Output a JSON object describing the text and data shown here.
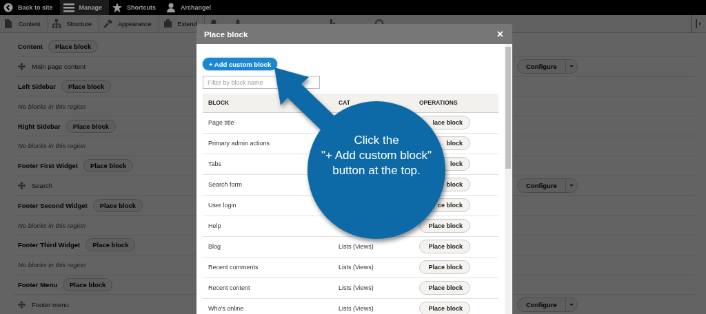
{
  "toolbar": {
    "items": [
      {
        "label": "Back to site",
        "selected": false
      },
      {
        "label": "Manage",
        "selected": true
      },
      {
        "label": "Shortcuts",
        "selected": false
      },
      {
        "label": "Archangel",
        "selected": false
      }
    ]
  },
  "admin_menu": [
    "Content",
    "Structure",
    "Appearance",
    "Extend"
  ],
  "regions": [
    {
      "title": "Content",
      "action": "Place block",
      "rows": [
        {
          "kind": "block",
          "label": "Main page content",
          "button": "Configure"
        }
      ]
    },
    {
      "title": "Left Sidebar",
      "action": "Place block",
      "rows": [
        {
          "kind": "empty",
          "label": "No blocks in this region"
        }
      ]
    },
    {
      "title": "Right Sidebar",
      "action": "Place block",
      "rows": [
        {
          "kind": "empty",
          "label": "No blocks in this region"
        }
      ]
    },
    {
      "title": "Footer First Widget",
      "action": "Place block",
      "rows": [
        {
          "kind": "block",
          "label": "Search",
          "button": "Configure"
        }
      ]
    },
    {
      "title": "Footer Second Widget",
      "action": "Place block",
      "rows": [
        {
          "kind": "empty",
          "label": "No blocks in this region"
        }
      ]
    },
    {
      "title": "Footer Third Widget",
      "action": "Place block",
      "rows": [
        {
          "kind": "empty",
          "label": "No blocks in this region"
        }
      ]
    },
    {
      "title": "Footer Menu",
      "action": "Place block",
      "rows": [
        {
          "kind": "block",
          "label": "Footer menu",
          "button": "Configure"
        }
      ]
    }
  ],
  "modal": {
    "title": "Place block",
    "close": "×",
    "add_button": "+ Add custom block",
    "filter": {
      "placeholder": "Filter by block name"
    },
    "table": {
      "columns": [
        "BLOCK",
        "CAT",
        "OPERATIONS"
      ],
      "rows": [
        {
          "block": "Page title",
          "operation": "lace block"
        },
        {
          "block": "Primary admin actions",
          "operation": "block"
        },
        {
          "block": "Tabs",
          "operation": "lock"
        },
        {
          "block": "Search form",
          "operation": "block"
        },
        {
          "block": "User login",
          "operation": "ce block"
        },
        {
          "block": "Help",
          "operation": "Place block"
        },
        {
          "block": "Blog",
          "category": "Lists (Views)",
          "operation": "Place block"
        },
        {
          "block": "Recent comments",
          "category": "Lists (Views)",
          "operation": "Place block"
        },
        {
          "block": "Recent content",
          "category": "Lists (Views)",
          "operation": "Place block"
        },
        {
          "block": "Who's online",
          "category": "Lists (Views)",
          "operation": "Place block"
        }
      ]
    }
  },
  "callout": {
    "text": "Click the\n\"+ Add custom block\"\nbutton at the top."
  }
}
